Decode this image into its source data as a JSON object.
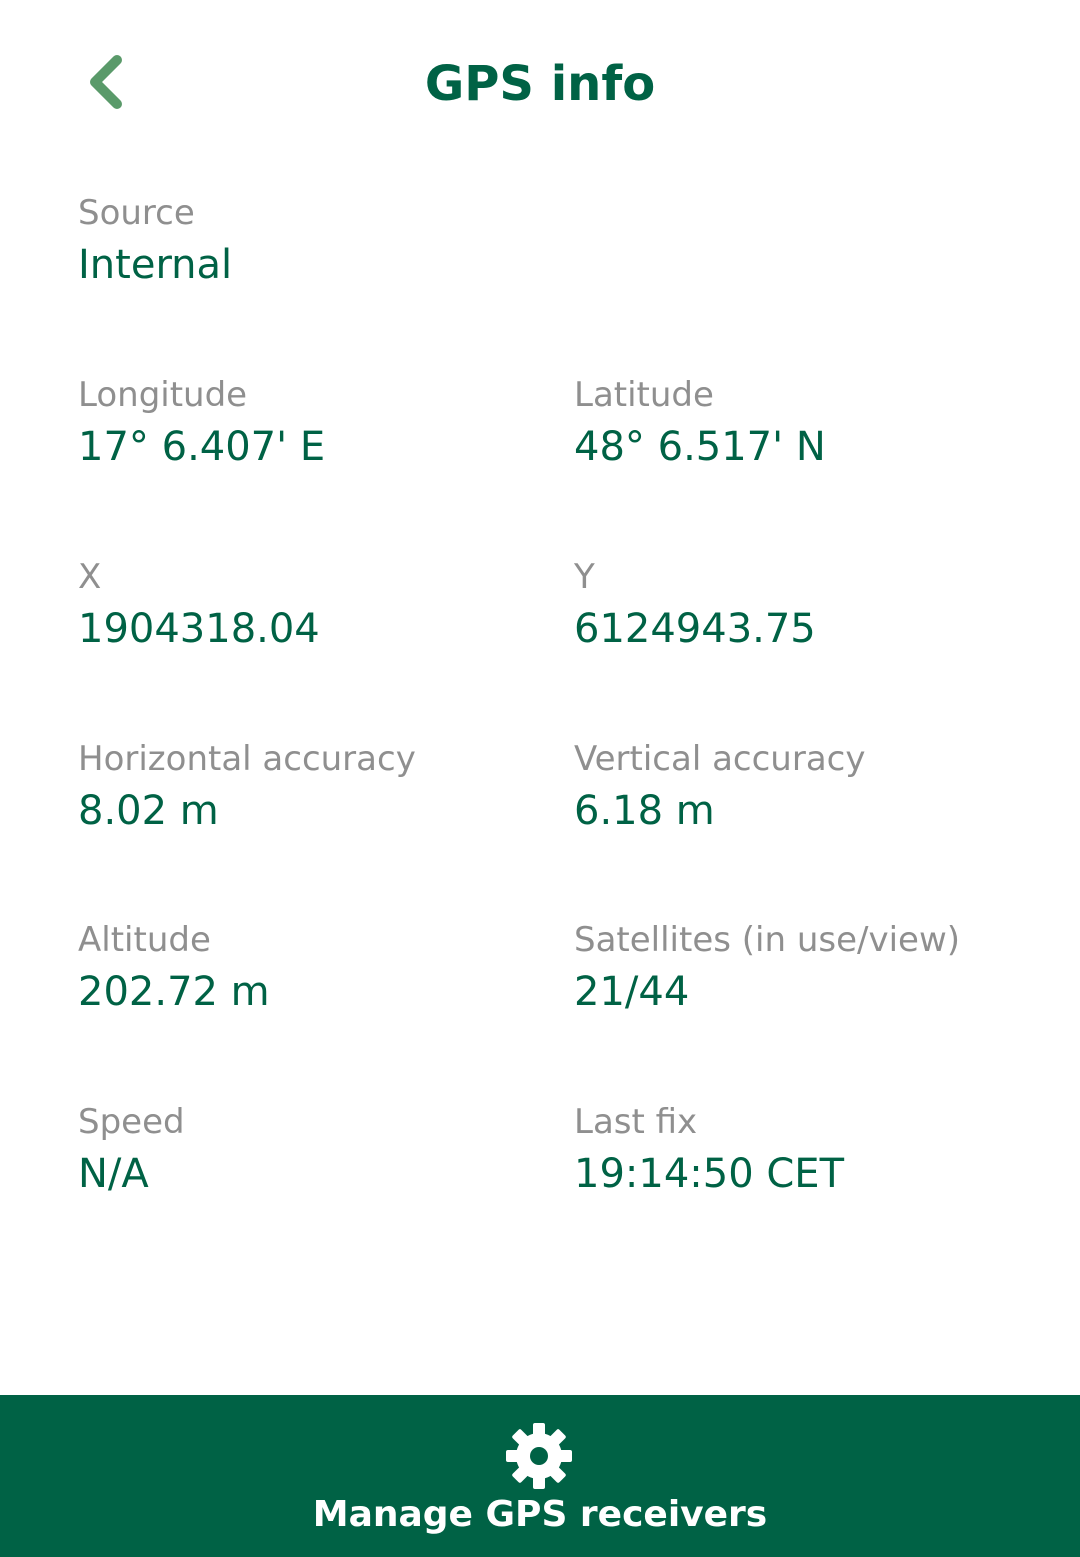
{
  "header": {
    "title": "GPS info",
    "back_icon": "chevron-left-icon"
  },
  "fields": {
    "source": {
      "label": "Source",
      "value": "Internal"
    },
    "longitude": {
      "label": "Longitude",
      "value": "17° 6.407' E"
    },
    "latitude": {
      "label": "Latitude",
      "value": "48° 6.517' N"
    },
    "x": {
      "label": "X",
      "value": "1904318.04"
    },
    "y": {
      "label": "Y",
      "value": "6124943.75"
    },
    "horizontal_accuracy": {
      "label": "Horizontal accuracy",
      "value": "8.02 m"
    },
    "vertical_accuracy": {
      "label": "Vertical accuracy",
      "value": "6.18 m"
    },
    "altitude": {
      "label": "Altitude",
      "value": "202.72 m"
    },
    "satellites": {
      "label": "Satellites (in use/view)",
      "value": "21/44"
    },
    "speed": {
      "label": "Speed",
      "value": "N/A"
    },
    "last_fix": {
      "label": "Last fix",
      "value": "19:14:50 CET"
    }
  },
  "footer": {
    "label": "Manage GPS receivers",
    "icon": "gear-icon"
  },
  "colors": {
    "accent": "#006245",
    "back_icon": "#5a9a6a",
    "label": "#8f8f8f",
    "footer_text": "#ffffff"
  }
}
